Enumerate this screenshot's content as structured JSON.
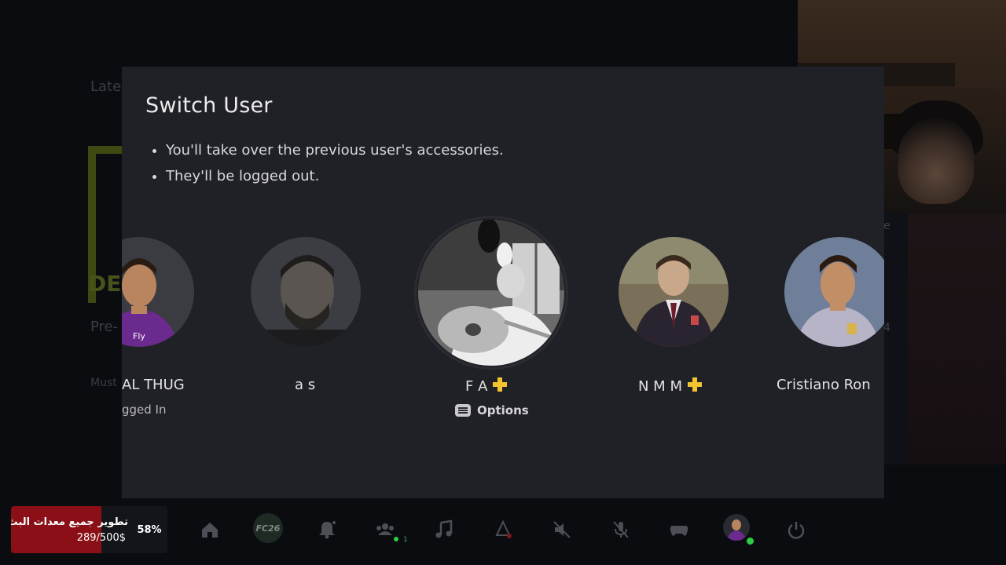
{
  "dialog": {
    "title": "Switch User",
    "bullets": [
      "You'll take over the previous user's accessories.",
      "They'll be logged out."
    ],
    "options_label": "Options"
  },
  "users": [
    {
      "name": "AL THUG",
      "visible_name": "AL THUG",
      "status": "Logged In",
      "visible_status": "gged In",
      "plus": false,
      "avatar": "cristiano-ronaldo-madrid-photo"
    },
    {
      "name": "a s",
      "status": "",
      "plus": false,
      "avatar": "bearded-man-portrait-photo"
    },
    {
      "name": "F A",
      "status": "",
      "plus": true,
      "selected": true,
      "avatar": "black-and-white-oud-player-photo"
    },
    {
      "name": "N M M",
      "status": "",
      "plus": true,
      "avatar": "boy-in-school-blazer-photo"
    },
    {
      "name": "Cristiano Ron",
      "status": "",
      "plus": false,
      "avatar": "cristiano-ronaldo-smiling-photo"
    }
  ],
  "background": {
    "faint_texts": [
      "Late",
      "Pre-",
      "Must"
    ],
    "right_digits": [
      "e",
      "4"
    ]
  },
  "control_bar": {
    "game_tile_label": "FC26",
    "party_count": "1",
    "icons": [
      "home-icon",
      "game-tile",
      "notification-icon",
      "game-base-icon",
      "music-icon",
      "accessibility-icon",
      "mute-icon",
      "mic-off-icon",
      "controller-icon",
      "profile-avatar",
      "power-icon"
    ]
  },
  "donation": {
    "title": "تطوير جميع معدات البث",
    "amount": "289/500$",
    "percent": "58%",
    "percent_value": 58
  },
  "colors": {
    "modal_bg": "#202126",
    "plus_gold": "#f4c430",
    "online_green": "#2fce49",
    "donation_red": "#8a0f16"
  }
}
